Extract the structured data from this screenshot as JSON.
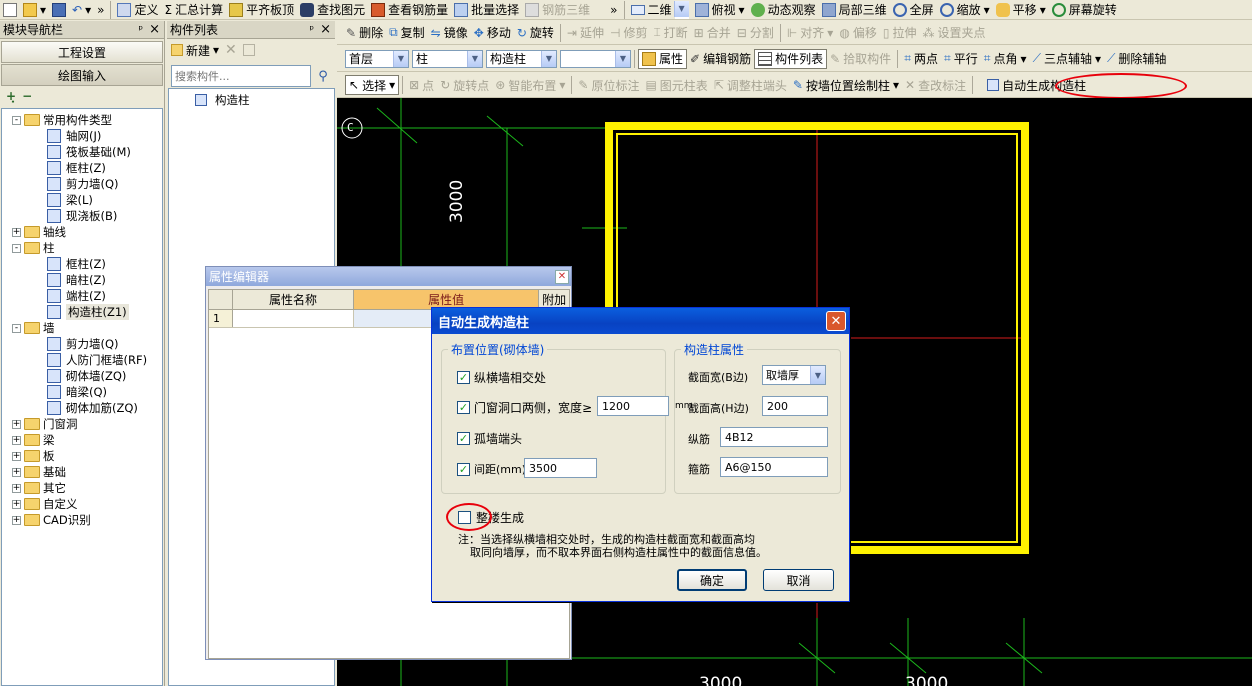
{
  "toolbar1": {
    "items": [
      "定义",
      "汇总计算",
      "平齐板顶",
      "查找图元",
      "查看钢筋量",
      "批量选择",
      "钢筋三维"
    ],
    "view_mode": "二维",
    "items_right": [
      "俯视",
      "动态观察",
      "局部三维",
      "全屏",
      "缩放",
      "平移",
      "屏幕旋转"
    ],
    "chevron": "»"
  },
  "nav": {
    "title": "模块导航栏",
    "pin": "ᵖ",
    "close": "×",
    "btn_settings": "工程设置",
    "btn_draw": "绘图输入",
    "tree": [
      {
        "label": "常用构件类型",
        "level": 0,
        "type": "folder",
        "expand": "-"
      },
      {
        "label": "轴网(J)",
        "level": 1,
        "type": "item"
      },
      {
        "label": "筏板基础(M)",
        "level": 1,
        "type": "item"
      },
      {
        "label": "框柱(Z)",
        "level": 1,
        "type": "item"
      },
      {
        "label": "剪力墙(Q)",
        "level": 1,
        "type": "item"
      },
      {
        "label": "梁(L)",
        "level": 1,
        "type": "item"
      },
      {
        "label": "现浇板(B)",
        "level": 1,
        "type": "item"
      },
      {
        "label": "轴线",
        "level": 0,
        "type": "folder",
        "expand": "+"
      },
      {
        "label": "柱",
        "level": 0,
        "type": "folder",
        "expand": "-"
      },
      {
        "label": "框柱(Z)",
        "level": 1,
        "type": "item"
      },
      {
        "label": "暗柱(Z)",
        "level": 1,
        "type": "item"
      },
      {
        "label": "端柱(Z)",
        "level": 1,
        "type": "item"
      },
      {
        "label": "构造柱(Z1)",
        "level": 1,
        "type": "item",
        "selected": true
      },
      {
        "label": "墙",
        "level": 0,
        "type": "folder",
        "expand": "-"
      },
      {
        "label": "剪力墙(Q)",
        "level": 1,
        "type": "item"
      },
      {
        "label": "人防门框墙(RF)",
        "level": 1,
        "type": "item"
      },
      {
        "label": "砌体墙(ZQ)",
        "level": 1,
        "type": "item"
      },
      {
        "label": "暗梁(Q)",
        "level": 1,
        "type": "item"
      },
      {
        "label": "砌体加筋(ZQ)",
        "level": 1,
        "type": "item"
      },
      {
        "label": "门窗洞",
        "level": 0,
        "type": "folder",
        "expand": "+"
      },
      {
        "label": "梁",
        "level": 0,
        "type": "folder",
        "expand": "+"
      },
      {
        "label": "板",
        "level": 0,
        "type": "folder",
        "expand": "+"
      },
      {
        "label": "基础",
        "level": 0,
        "type": "folder",
        "expand": "+"
      },
      {
        "label": "其它",
        "level": 0,
        "type": "folder",
        "expand": "+"
      },
      {
        "label": "自定义",
        "level": 0,
        "type": "folder",
        "expand": "+"
      },
      {
        "label": "CAD识别",
        "level": 0,
        "type": "folder",
        "expand": "+"
      }
    ]
  },
  "comp": {
    "title": "构件列表",
    "new": "新建",
    "search_placeholder": "搜索构件...",
    "item": "构造柱"
  },
  "toolbar2": {
    "items": [
      "删除",
      "复制",
      "镜像",
      "移动",
      "旋转",
      "延伸",
      "修剪",
      "打断",
      "合并",
      "分割",
      "对齐",
      "偏移",
      "拉伸",
      "设置夹点"
    ]
  },
  "toolbar3": {
    "floor": "首层",
    "type": "柱",
    "comp": "构造柱",
    "extra": "",
    "items": [
      "属性",
      "编辑钢筋",
      "构件列表",
      "拾取构件",
      "两点",
      "平行",
      "点角",
      "三点辅轴",
      "删除辅轴"
    ]
  },
  "toolbar4": {
    "items": [
      "选择",
      "点",
      "旋转点",
      "智能布置",
      "原位标注",
      "图元柱表",
      "调整柱端头",
      "按墙位置绘制柱",
      "查改标注",
      "自动生成构造柱"
    ]
  },
  "cad": {
    "axis_label": "C",
    "dim_left": "3000",
    "dim_bottom_left": "3000",
    "dim_bottom_right": "3000"
  },
  "prop": {
    "title": "属性编辑器",
    "col_name": "属性名称",
    "col_value": "属性值",
    "col_extra": "附加",
    "row_no": "1"
  },
  "dialog": {
    "title": "自动生成构造柱",
    "group_left": "布置位置(砌体墙)",
    "opt1": "纵横墙相交处",
    "opt2": "门窗洞口两侧，宽度≥",
    "opt2_value": "1200",
    "opt2_unit": "mm",
    "opt3": "孤墙端头",
    "opt4": "间距(mm)",
    "opt4_value": "3500",
    "group_right": "构造柱属性",
    "width_label": "截面宽(B边)",
    "width_value": "取墙厚",
    "height_label": "截面高(H边)",
    "height_value": "200",
    "long_label": "纵筋",
    "long_value": "4B12",
    "stir_label": "箍筋",
    "stir_value": "A6@150",
    "whole_floor": "整楼生成",
    "note1": "注：当选择纵横墙相交处时，生成的构造柱截面宽和截面高均",
    "note2": "取同向墙厚，而不取本界面右侧构造柱属性中的截面信息值。",
    "ok": "确定",
    "cancel": "取消"
  }
}
